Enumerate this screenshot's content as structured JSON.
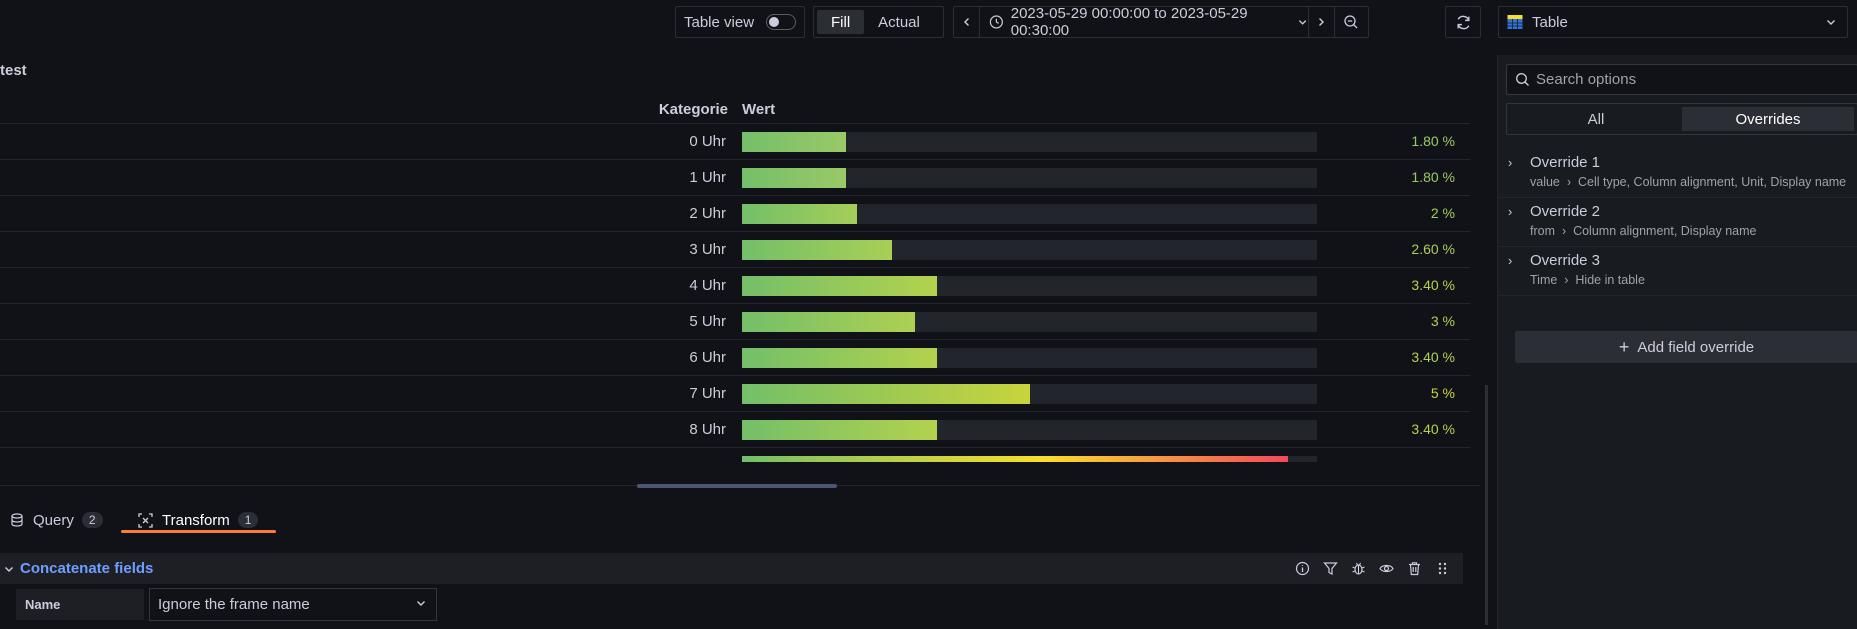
{
  "toolbar": {
    "table_view_label": "Table view",
    "fill_label": "Fill",
    "actual_label": "Actual",
    "time_range": "2023-05-29 00:00:00 to 2023-05-29 00:30:00",
    "visualization": "Table"
  },
  "panel": {
    "title": "test",
    "columns": [
      "Kategorie",
      "Wert"
    ],
    "rows": [
      {
        "category": "0 Uhr",
        "value_text": "1.80 %",
        "value": 1.8,
        "color": "#9bc968"
      },
      {
        "category": "1 Uhr",
        "value_text": "1.80 %",
        "value": 1.8,
        "color": "#9bc968"
      },
      {
        "category": "2 Uhr",
        "value_text": "2 %",
        "value": 2,
        "color": "#a5ce58"
      },
      {
        "category": "3 Uhr",
        "value_text": "2.60 %",
        "value": 2.6,
        "color": "#a9cf55"
      },
      {
        "category": "4 Uhr",
        "value_text": "3.40 %",
        "value": 3.4,
        "color": "#b3d24d"
      },
      {
        "category": "5 Uhr",
        "value_text": "3 %",
        "value": 3,
        "color": "#aed052"
      },
      {
        "category": "6 Uhr",
        "value_text": "3.40 %",
        "value": 3.4,
        "color": "#b3d24d"
      },
      {
        "category": "7 Uhr",
        "value_text": "5 %",
        "value": 5,
        "color": "#c8d43c"
      },
      {
        "category": "8 Uhr",
        "value_text": "3.40 %",
        "value": 3.4,
        "color": "#b3d24d"
      },
      {
        "category": "",
        "value_text": "",
        "value": 9.5,
        "color": "#e06b4a"
      }
    ],
    "gauge_max": 10
  },
  "tabs": [
    {
      "label": "Query",
      "count": "2"
    },
    {
      "label": "Transform",
      "count": "1"
    }
  ],
  "transform": {
    "title": "Concatenate fields",
    "name_label": "Name",
    "name_value": "Ignore the frame name"
  },
  "options": {
    "search_placeholder": "Search options",
    "radio_all": "All",
    "radio_overrides": "Overrides",
    "overrides": [
      {
        "title": "Override 1",
        "matcher": "value",
        "props": "Cell type, Column alignment, Unit, Display name"
      },
      {
        "title": "Override 2",
        "matcher": "from",
        "props": "Column alignment, Display name"
      },
      {
        "title": "Override 3",
        "matcher": "Time",
        "props": "Hide in table"
      }
    ],
    "add_label": "Add field override"
  },
  "colors": {
    "accent_orange": "#ff7b3a",
    "link_blue": "#6e9fff",
    "gauge_green": "#73bf69",
    "gauge_yellow": "#fade2a",
    "gauge_red": "#f2495c"
  }
}
